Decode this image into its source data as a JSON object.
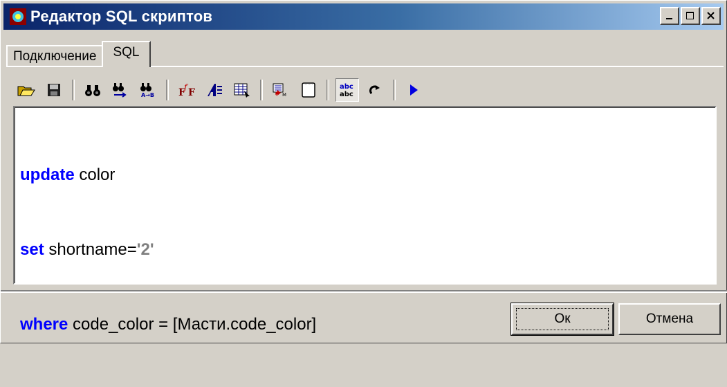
{
  "window": {
    "title": "Редактор SQL скриптов"
  },
  "tabs": [
    {
      "label": "Подключение",
      "active": false
    },
    {
      "label": "SQL",
      "active": true
    }
  ],
  "toolbar": {
    "buttons": [
      "open-folder-icon",
      "save-disk-icon",
      "find-icon",
      "find-next-icon",
      "replace-icon",
      "font-script-icon",
      "font-icon",
      "grid-select-icon",
      "insert-field-icon",
      "new-page-icon",
      "spellcheck-icon",
      "redo-icon",
      "run-icon"
    ]
  },
  "editor": {
    "lines": [
      {
        "kw": "update",
        "rest": " color"
      },
      {
        "kw": "set",
        "rest": " shortname=",
        "str": "'2'"
      },
      {
        "kw": "where",
        "rest": " code_color = [Масти.code_color]"
      }
    ]
  },
  "buttons": {
    "ok": "Ок",
    "cancel": "Отмена"
  },
  "colors": {
    "keyword": "#0000ff",
    "string": "#808080",
    "titlebar_start": "#0a246a",
    "titlebar_end": "#a6caf0"
  }
}
